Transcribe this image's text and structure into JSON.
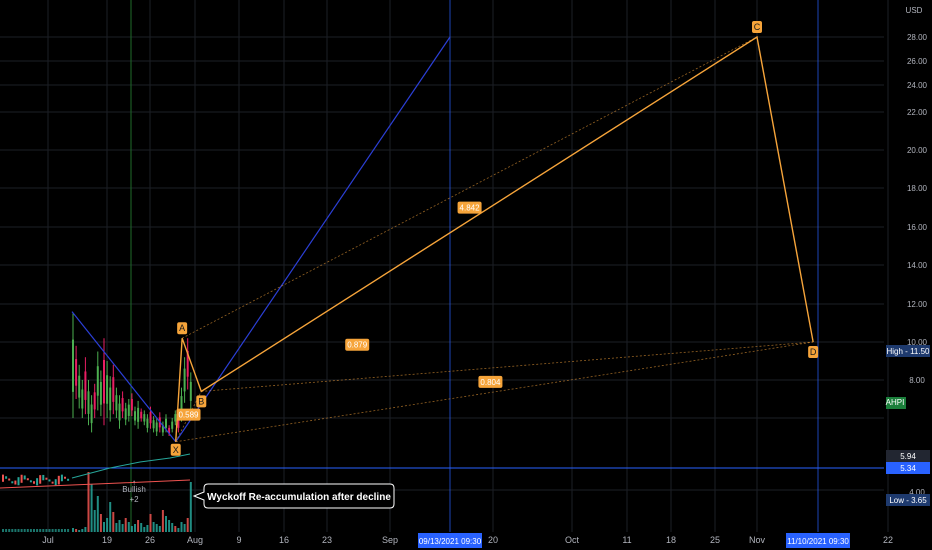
{
  "chart_data": {
    "type": "candlestick-pattern",
    "currency": "USD",
    "ticker_label": "AHPI",
    "y_ticks": [
      "28.00",
      "26.00",
      "24.00",
      "22.00",
      "20.00",
      "18.00",
      "16.00",
      "14.00",
      "12.00",
      "10.00",
      "8.00",
      "4.00"
    ],
    "x_ticks": [
      "Jul",
      "19",
      "26",
      "Aug",
      "9",
      "16",
      "23",
      "Sep",
      "20",
      "Oct",
      "11",
      "18",
      "25",
      "Nov",
      "22"
    ],
    "time_marker_1": "09/13/2021  09:30",
    "time_marker_2": "11/10/2021  09:30",
    "price_tags": {
      "high": "High  -  11.50",
      "last1": "5.94",
      "last2": "5.34",
      "low": "Low  -  3.65"
    },
    "harmonic_points": [
      {
        "label": "X",
        "date": "2021-07-30",
        "price": 5.34
      },
      {
        "label": "A",
        "date": "2021-07-31",
        "price": 10.2
      },
      {
        "label": "B",
        "date": "2021-08-03",
        "price": 7.4
      },
      {
        "label": "C",
        "date": "2021-11-01",
        "price": 28.0
      },
      {
        "label": "D",
        "date": "2021-11-10",
        "price": 10.0
      }
    ],
    "ratios": [
      "0.589",
      "4.842",
      "0.879",
      "0.804"
    ],
    "signal": {
      "label": "Bullish",
      "value": "+2"
    },
    "annotation": "Wyckoff Re-accumulation after decline"
  },
  "colors": {
    "pattern": "#f6a43a",
    "blue": "#2b3fd6",
    "bull": "#26a69a",
    "bear": "#ef5350",
    "green_bar": "#4caf50",
    "pink_bar": "#e91e63",
    "tag_blue": "#2962ff",
    "tag_navy": "#1e3a6e",
    "tag_green": "#1b7f3b"
  }
}
